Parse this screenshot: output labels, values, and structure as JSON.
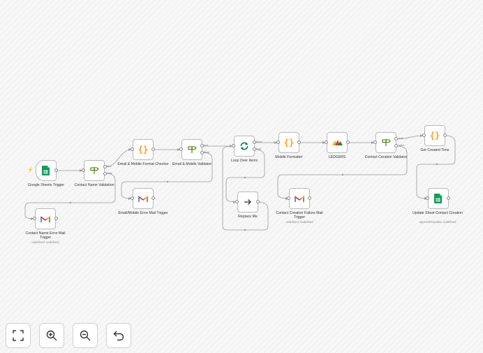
{
  "nodes": [
    {
      "id": "sheets_trigger",
      "label": "Google Sheets Trigger",
      "icon": "google-sheets-icon"
    },
    {
      "id": "name_validation",
      "label": "Contact Name Validation",
      "icon": "if-signpost-icon"
    },
    {
      "id": "format_checker",
      "label": "Email & Mobile Format Checker",
      "icon": "code-braces-icon"
    },
    {
      "id": "em_validator",
      "label": "Email & Mobile Validator",
      "icon": "if-signpost-icon"
    },
    {
      "id": "loop",
      "label": "Loop Over Items",
      "icon": "loop-icon"
    },
    {
      "id": "mobile_formatter",
      "label": "Mobile Formatter",
      "icon": "code-braces-icon"
    },
    {
      "id": "ledgers",
      "label": "LEDGERS",
      "icon": "ledgers-logo-icon"
    },
    {
      "id": "creation_validator",
      "label": "Contact Creation Validator",
      "icon": "if-signpost-icon"
    },
    {
      "id": "created_time",
      "label": "Get Created Time",
      "icon": "code-braces-icon"
    },
    {
      "id": "name_error_mail",
      "label": "Contact Name Error Mail Trigger",
      "sub": "undefined: undefined",
      "icon": "gmail-icon"
    },
    {
      "id": "format_error_mail",
      "label": "Email/Mobile Error Mail Trigger",
      "icon": "gmail-icon"
    },
    {
      "id": "replace_me",
      "label": "Replace Me",
      "icon": "arrow-right-icon"
    },
    {
      "id": "creation_failure_mail",
      "label": "Contact Creation Failure Mail Trigger",
      "sub": "undefined: undefined",
      "icon": "gmail-icon"
    },
    {
      "id": "update_sheet",
      "label": "Update Sheet Contact Creation",
      "sub": "appendOrUpdate: undefined",
      "icon": "google-sheets-icon"
    }
  ],
  "branches": {
    "true_label": "true",
    "false_label": "false",
    "done_label": "done",
    "loop_label": "loop"
  },
  "controls": [
    {
      "name": "fit-view-button",
      "icon": "fit-view-icon"
    },
    {
      "name": "zoom-in-button",
      "icon": "zoom-in-icon"
    },
    {
      "name": "zoom-out-button",
      "icon": "zoom-out-icon"
    },
    {
      "name": "reset-zoom-button",
      "icon": "undo-icon"
    }
  ],
  "colors": {
    "sheets_green": "#0f9d58",
    "if_green": "#408000",
    "code_orange": "#ff9922",
    "loop_green": "#007755",
    "trigger_bolt": "#ff6d5a",
    "edge_gray": "#9a9a9a"
  }
}
